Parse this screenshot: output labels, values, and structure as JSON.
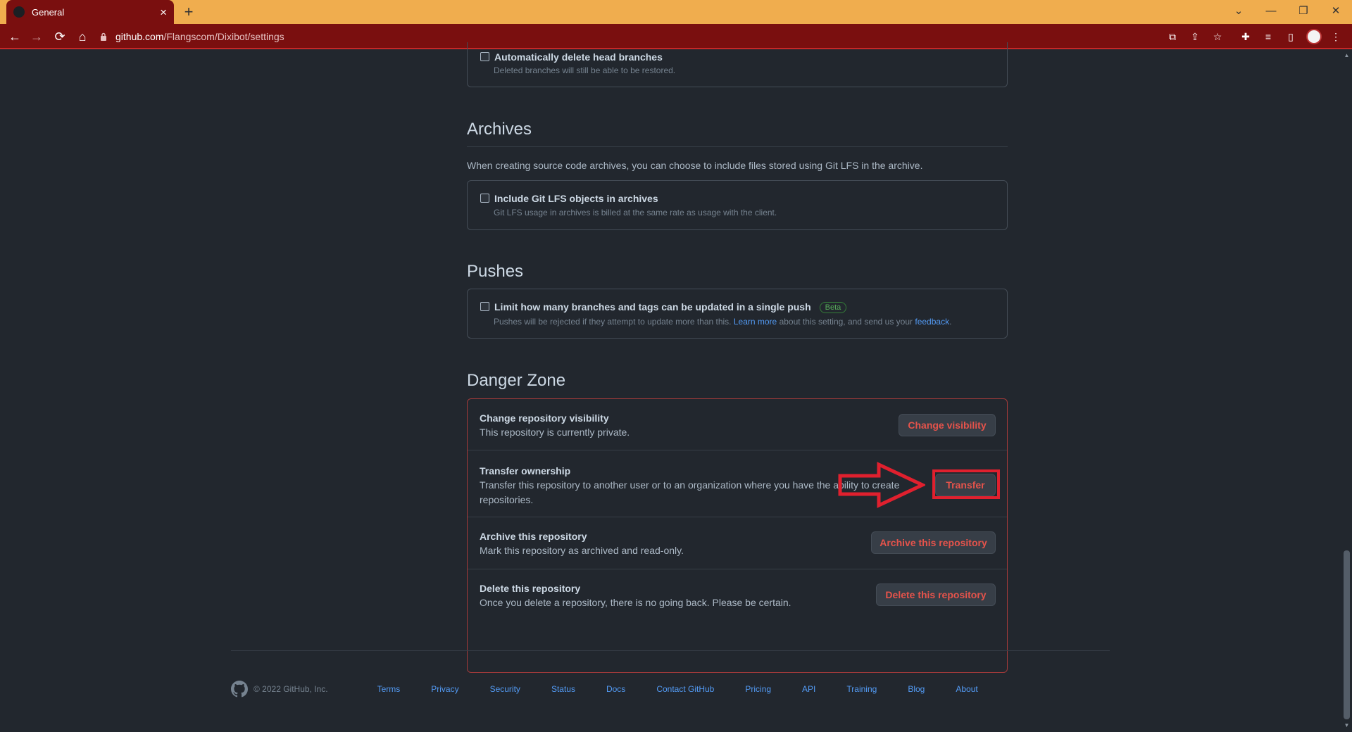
{
  "browser": {
    "tab_title": "General",
    "url_host": "github.com",
    "url_path": "/Flangscom/Dixibot/settings"
  },
  "auto_delete": {
    "label": "Automatically delete head branches",
    "note": "Deleted branches will still be able to be restored."
  },
  "archives": {
    "heading": "Archives",
    "description": "When creating source code archives, you can choose to include files stored using Git LFS in the archive.",
    "option_label": "Include Git LFS objects in archives",
    "option_note": "Git LFS usage in archives is billed at the same rate as usage with the client."
  },
  "pushes": {
    "heading": "Pushes",
    "option_label": "Limit how many branches and tags can be updated in a single push",
    "badge": "Beta",
    "note_before": "Pushes will be rejected if they attempt to update more than this. ",
    "learn_more": "Learn more",
    "note_middle": " about this setting, and send us your ",
    "feedback": "feedback",
    "note_end": "."
  },
  "danger_zone": {
    "heading": "Danger Zone",
    "items": [
      {
        "title": "Change repository visibility",
        "description": "This repository is currently private.",
        "button": "Change visibility"
      },
      {
        "title": "Transfer ownership",
        "description": "Transfer this repository to another user or to an organization where you have the ability to create repositories.",
        "button": "Transfer"
      },
      {
        "title": "Archive this repository",
        "description": "Mark this repository as archived and read-only.",
        "button": "Archive this repository"
      },
      {
        "title": "Delete this repository",
        "description": "Once you delete a repository, there is no going back. Please be certain.",
        "button": "Delete this repository"
      }
    ]
  },
  "footer": {
    "copyright": "© 2022 GitHub, Inc.",
    "links": [
      "Terms",
      "Privacy",
      "Security",
      "Status",
      "Docs",
      "Contact GitHub",
      "Pricing",
      "API",
      "Training",
      "Blog",
      "About"
    ]
  },
  "colors": {
    "page_bg": "#22272e",
    "danger": "#e5534b",
    "annotation_red": "#e0202e",
    "link": "#539bf5",
    "chrome_toolbar": "#7a0f0f",
    "chrome_titlebar": "#f0ad4e"
  },
  "icons": [
    "back-arrow-icon",
    "forward-arrow-icon",
    "reload-icon",
    "home-icon",
    "lock-icon",
    "translate-icon",
    "share-icon",
    "star-icon",
    "extensions-icon",
    "media-icon",
    "side-panel-icon",
    "menu-icon",
    "github-mark-icon"
  ]
}
